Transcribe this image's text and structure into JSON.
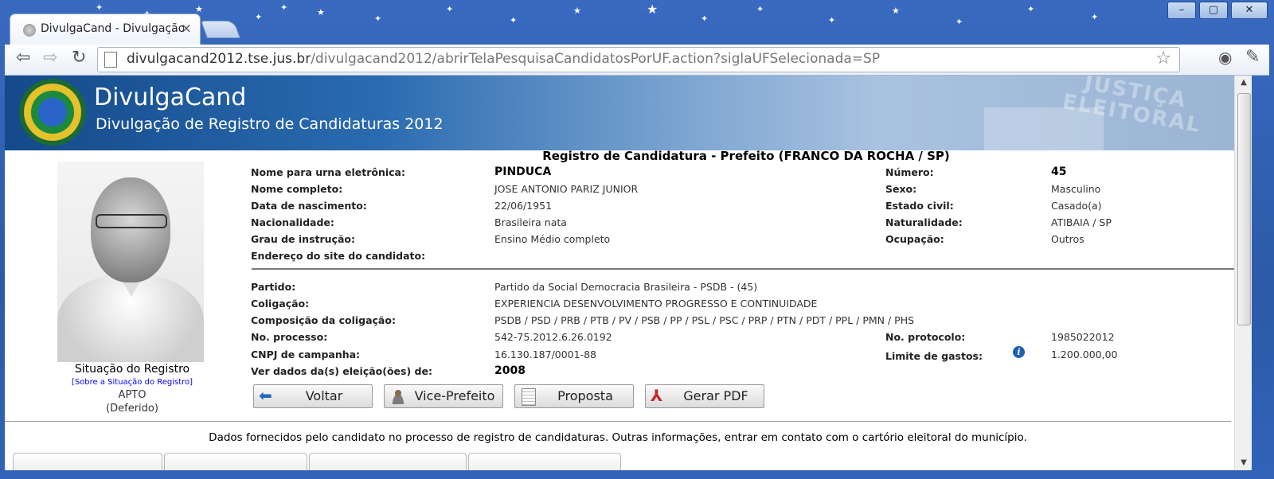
{
  "browser": {
    "tab_title": "DivulgaCand - Divulgação",
    "tab_close": "×",
    "url_host": "divulgacand2012.tse.jus.br",
    "url_path": "/divulgacand2012/abrirTelaPesquisaCandidatosPorUF.action?siglaUFSelecionada=SP",
    "window_controls": {
      "minimize": "–",
      "maximize": "▢",
      "close": "✕"
    },
    "icons": [
      "back-icon",
      "forward-icon",
      "reload-icon",
      "star-icon",
      "eye-icon",
      "wrench-icon"
    ]
  },
  "banner": {
    "brand": "DivulgaCand",
    "subtitle": "Divulgação de Registro de Candidaturas 2012",
    "stamp_line1": "JUSTIÇA",
    "stamp_line2": "ELEITORAL"
  },
  "record": {
    "title": "Registro de Candidatura - Prefeito (FRANCO DA ROCHA / SP)",
    "left_fields": [
      {
        "label": "Nome para urna eletrônica:",
        "value": "PINDUCA"
      },
      {
        "label": "Nome completo:",
        "value": "JOSE ANTONIO PARIZ JUNIOR"
      },
      {
        "label": "Data de nascimento:",
        "value": "22/06/1951"
      },
      {
        "label": "Nacionalidade:",
        "value": "Brasileira nata"
      },
      {
        "label": "Grau de instrução:",
        "value": "Ensino Médio completo"
      },
      {
        "label": "Endereço do site do candidato:",
        "value": ""
      }
    ],
    "right_fields": [
      {
        "label": "Número:",
        "value": "45"
      },
      {
        "label": "Sexo:",
        "value": "Masculino"
      },
      {
        "label": "Estado civil:",
        "value": "Casado(a)"
      },
      {
        "label": "Naturalidade:",
        "value": "ATIBAIA / SP"
      },
      {
        "label": "Ocupação:",
        "value": "Outros"
      }
    ],
    "party_fields": [
      {
        "label": "Partido:",
        "value": "Partido da Social Democracia Brasileira -  PSDB - (45)"
      },
      {
        "label": "Coligação:",
        "value": "EXPERIENCIA DESENVOLVIMENTO PROGRESSO E CONTINUIDADE"
      },
      {
        "label": "Composição da coligação:",
        "value": "PSDB / PSD / PRB / PTB / PV / PSB / PP / PSL / PSC / PRP / PTN / PDT / PPL / PMN / PHS"
      },
      {
        "label": "No. processo:",
        "value": "542-75.2012.6.26.0192"
      },
      {
        "label": "CNPJ de campanha:",
        "value": "16.130.187/0001-88"
      },
      {
        "label": "Ver dados da(s) eleição(ões) de:",
        "value": "2008"
      }
    ],
    "protocol": {
      "label": "No. protocolo:",
      "value": "1985022012"
    },
    "spending": {
      "label": "Limite de gastos:",
      "value": "1.200.000,00",
      "info_glyph": "i"
    }
  },
  "registration": {
    "label": "Situação do Registro",
    "link": "[Sobre a Situação do Registro]",
    "status": "APTO",
    "detail": "(Deferido)"
  },
  "buttons": [
    {
      "label": "Voltar",
      "icon": "back-arrow-icon"
    },
    {
      "label": "Vice-Prefeito",
      "icon": "person-icon"
    },
    {
      "label": "Proposta",
      "icon": "document-icon"
    },
    {
      "label": "Gerar PDF",
      "icon": "pdf-icon"
    }
  ],
  "footer": {
    "text": "Dados fornecidos pelo candidato no processo de registro de candidaturas.  Outras informações, entrar em contato com o cartório eleitoral do município."
  },
  "colors": {
    "banner_dark": "#144a8a",
    "link": "#0000ff",
    "info": "#1e5fb5",
    "frame": "#2a5aa8"
  }
}
